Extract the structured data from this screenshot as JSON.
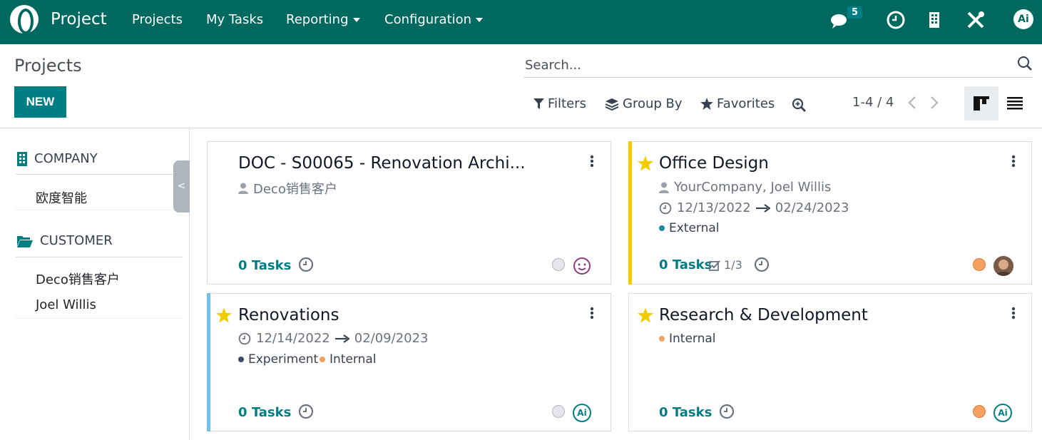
{
  "colors": {
    "navbar": "#00695f",
    "primary": "#017e84",
    "star": "#f3cc00",
    "stripe_yellow": "#f3cc00",
    "stripe_blue": "#6cc1ed"
  },
  "nav": {
    "app_name": "Project",
    "items": [
      {
        "label": "Projects",
        "dropdown": false
      },
      {
        "label": "My Tasks",
        "dropdown": false
      },
      {
        "label": "Reporting",
        "dropdown": true
      },
      {
        "label": "Configuration",
        "dropdown": true
      }
    ],
    "messages_count": "5",
    "user_initials": "Ai"
  },
  "control": {
    "title": "Projects",
    "new_label": "NEW",
    "search_placeholder": "Search...",
    "filters_label": "Filters",
    "groupby_label": "Group By",
    "favorites_label": "Favorites",
    "pager": "1-4 / 4"
  },
  "sidebar": {
    "company_header": "COMPANY",
    "company_items": [
      "欧度智能"
    ],
    "customer_header": "CUSTOMER",
    "customer_items": [
      "Deco销售客户",
      "Joel Willis"
    ],
    "toggle_label": "<"
  },
  "cards": [
    {
      "title": "DOC - S00065 - Renovation Archi...",
      "starred": false,
      "customer": "Deco销售客户",
      "tasks_count": "0",
      "tasks_label": "Tasks",
      "status": "grey",
      "avatar": "smiley"
    },
    {
      "title": "Office Design",
      "starred": true,
      "stripe": "yellow",
      "customer": "YourCompany, Joel Willis",
      "date_start": "12/13/2022",
      "date_end": "02/24/2023",
      "tags": [
        {
          "label": "External",
          "color": "#1f8a99"
        }
      ],
      "tasks_count": "0",
      "tasks_label": "Tasks",
      "milestones": "1/3",
      "status": "orange",
      "avatar": "photo"
    },
    {
      "title": "Renovations",
      "starred": true,
      "stripe": "blue",
      "date_start": "12/14/2022",
      "date_end": "02/09/2023",
      "tags": [
        {
          "label": "Experiment",
          "color": "#3c4a63"
        },
        {
          "label": "Internal",
          "color": "#f4a261"
        }
      ],
      "tasks_count": "0",
      "tasks_label": "Tasks",
      "status": "grey",
      "avatar": "Ai"
    },
    {
      "title": "Research & Development",
      "starred": true,
      "tags": [
        {
          "label": "Internal",
          "color": "#f4a261"
        }
      ],
      "tasks_count": "0",
      "tasks_label": "Tasks",
      "status": "orange",
      "avatar": "Ai"
    }
  ]
}
